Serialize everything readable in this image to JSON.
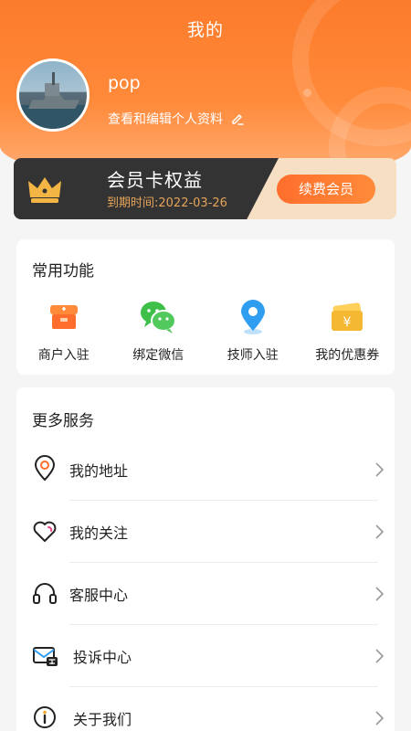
{
  "header": {
    "title": "我的",
    "username": "pop",
    "edit_profile": "查看和编辑个人资料"
  },
  "member": {
    "title": "会员卡权益",
    "expire": "到期时间:2022-03-26",
    "renew_button": "续费会员"
  },
  "common_functions": {
    "title": "常用功能",
    "items": [
      {
        "label": "商户入驻",
        "icon": "merchant-icon"
      },
      {
        "label": "绑定微信",
        "icon": "wechat-icon"
      },
      {
        "label": "技师入驻",
        "icon": "location-pin-icon"
      },
      {
        "label": "我的优惠券",
        "icon": "coupon-icon"
      }
    ]
  },
  "more_services": {
    "title": "更多服务",
    "items": [
      {
        "label": "我的地址",
        "icon": "address-pin-icon"
      },
      {
        "label": "我的关注",
        "icon": "heart-icon"
      },
      {
        "label": "客服中心",
        "icon": "headset-icon"
      },
      {
        "label": "投诉中心",
        "icon": "complaint-mail-icon"
      },
      {
        "label": "关于我们",
        "icon": "info-icon"
      }
    ]
  },
  "colors": {
    "primary_orange": "#fb7b2b",
    "member_dark": "#333333",
    "member_gold": "#e6a45a",
    "wechat_green": "#3dbf4a",
    "pin_blue": "#2f9df0",
    "coupon_gold": "#f5b833"
  }
}
